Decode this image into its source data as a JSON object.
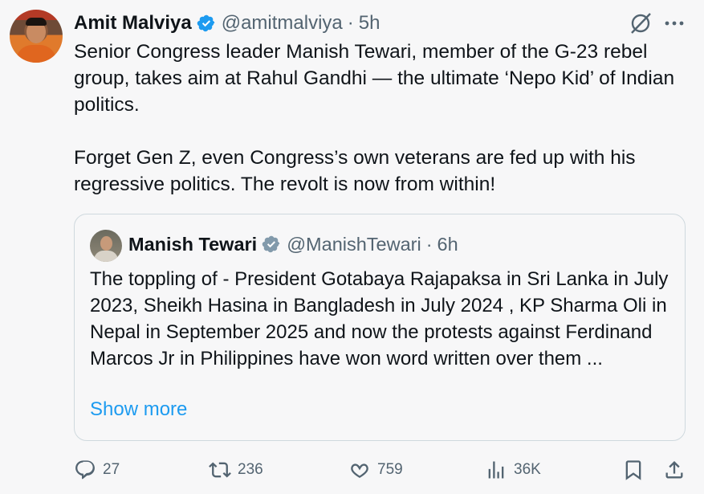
{
  "author": {
    "name": "Amit Malviya",
    "handle": "@amitmalviya",
    "dot": "·",
    "time": "5h"
  },
  "tweet_text": "Senior Congress leader Manish Tewari, member of the G-23 rebel group, takes aim at Rahul Gandhi — the ultimate ‘Nepo Kid’ of Indian politics.\n\nForget Gen Z, even Congress’s own veterans are fed up with his regressive politics. The revolt is now from within!",
  "quoted": {
    "name": "Manish Tewari",
    "handle": "@ManishTewari",
    "dot": "·",
    "time": "6h",
    "text": "The toppling of - President Gotabaya Rajapaksa in Sri Lanka in July 2023, Sheikh Hasina in Bangladesh in July 2024 , KP Sharma Oli in Nepal in September 2025 and now the protests against Ferdinand Marcos Jr in Philippines have won word written over them ...",
    "show_more": "Show more"
  },
  "actions": {
    "replies": "27",
    "reposts": "236",
    "likes": "759",
    "views": "36K"
  },
  "colors": {
    "verified": "#1d9bf0",
    "quoted_verified": "#829aab",
    "link": "#1d9bf0",
    "muted": "#536471"
  }
}
